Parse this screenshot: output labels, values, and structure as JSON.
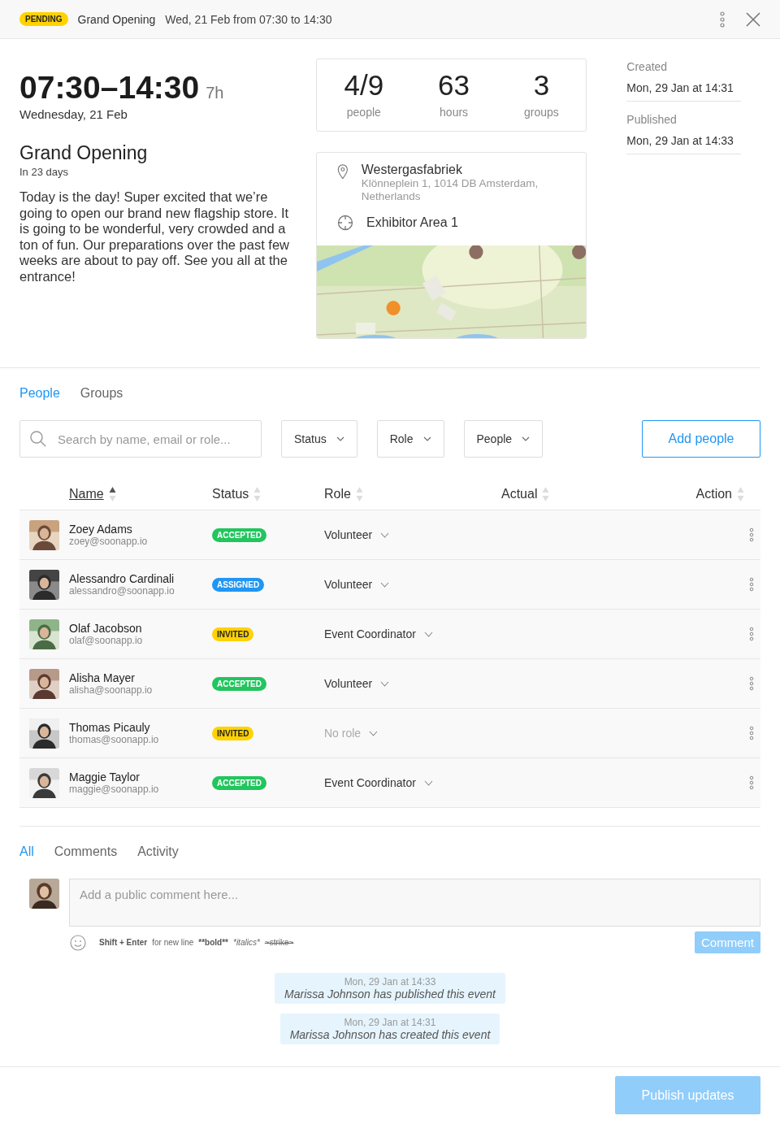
{
  "header": {
    "status": "PENDING",
    "title": "Grand Opening",
    "when": "Wed, 21 Feb from 07:30 to 14:30"
  },
  "event": {
    "time": "07:30–14:30",
    "duration": "7h",
    "date": "Wednesday, 21 Feb",
    "title": "Grand Opening",
    "countdown": "In 23 days",
    "description": "Today is the day! Super excited that we’re going to open our brand new flagship store. It is going to be wonderful, very crowded and a ton of fun. Our preparations over the past few weeks are about to pay off. See you all at the entrance!"
  },
  "stats": [
    {
      "value": "4/9",
      "label": "people"
    },
    {
      "value": "63",
      "label": "hours"
    },
    {
      "value": "3",
      "label": "groups"
    }
  ],
  "location": {
    "venue": "Westergasfabriek",
    "address": "Klönneplein 1, 1014 DB Amsterdam, Netherlands",
    "area": "Exhibitor Area 1"
  },
  "history": [
    {
      "label": "Created",
      "value": "Mon, 29 Jan at 14:31"
    },
    {
      "label": "Published",
      "value": "Mon, 29 Jan at 14:33"
    }
  ],
  "tabs": [
    {
      "label": "People",
      "selected": true
    },
    {
      "label": "Groups",
      "selected": false
    }
  ],
  "search": {
    "placeholder": "Search by name, email or role..."
  },
  "filters": [
    "Status",
    "Role",
    "People"
  ],
  "add_button": "Add people",
  "columns": [
    {
      "label": "Name",
      "sorted": true
    },
    {
      "label": "Status",
      "sorted": false
    },
    {
      "label": "Role",
      "sorted": false
    },
    {
      "label": "Actual",
      "sorted": false
    },
    {
      "label": "Action",
      "sorted": false
    }
  ],
  "people": [
    {
      "name": "Zoey Adams",
      "email": "zoey@soonapp.io",
      "status": "ACCEPTED",
      "color": "#22c55e",
      "role": "Volunteer",
      "role_set": true
    },
    {
      "name": "Alessandro Cardinali",
      "email": "alessandro@soonapp.io",
      "status": "ASSIGNED",
      "color": "#2196f3",
      "role": "Volunteer",
      "role_set": true
    },
    {
      "name": "Olaf Jacobson",
      "email": "olaf@soonapp.io",
      "status": "INVITED",
      "color": "#ffd200",
      "role": "Event Coordinator",
      "role_set": true
    },
    {
      "name": "Alisha Mayer",
      "email": "alisha@soonapp.io",
      "status": "ACCEPTED",
      "color": "#22c55e",
      "role": "Volunteer",
      "role_set": true
    },
    {
      "name": "Thomas Picauly",
      "email": "thomas@soonapp.io",
      "status": "INVITED",
      "color": "#ffd200",
      "role": "No role",
      "role_set": false
    },
    {
      "name": "Maggie Taylor",
      "email": "maggie@soonapp.io",
      "status": "ACCEPTED",
      "color": "#22c55e",
      "role": "Event Coordinator",
      "role_set": true
    }
  ],
  "comment_tabs": [
    {
      "label": "All",
      "selected": true
    },
    {
      "label": "Comments",
      "selected": false
    },
    {
      "label": "Activity",
      "selected": false
    }
  ],
  "comment": {
    "placeholder": "Add a public comment here...",
    "hints": [
      {
        "kind": "bold",
        "text": "Shift + Enter"
      },
      {
        "kind": "plain",
        "text": "for new line"
      },
      {
        "kind": "bold",
        "text": "**bold**"
      },
      {
        "kind": "italic",
        "text": "*italics*"
      },
      {
        "kind": "strike",
        "text": "~strike~"
      }
    ],
    "button": "Comment",
    "disabled": true
  },
  "activity": [
    {
      "time": "Mon, 29 Jan at 14:33",
      "text": "Marissa Johnson has published this event"
    },
    {
      "time": "Mon, 29 Jan at 14:31",
      "text": "Marissa Johnson has created this event"
    }
  ],
  "publish": {
    "label": "Publish updates",
    "disabled": true
  }
}
